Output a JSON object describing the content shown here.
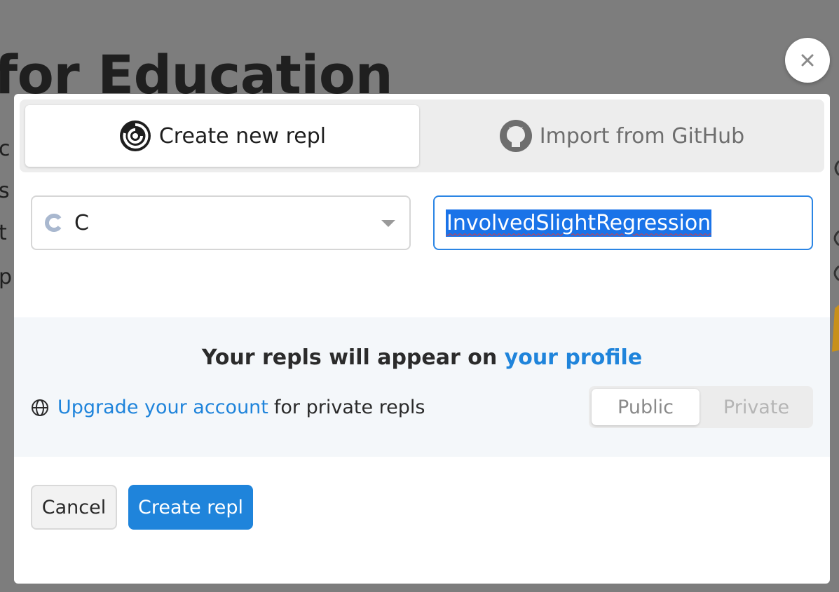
{
  "background": {
    "title": "for Education",
    "fragments": [
      "c",
      "s",
      "t",
      "p"
    ]
  },
  "modal": {
    "tabs": [
      {
        "label": "Create new repl",
        "icon": "replit-swirl-icon",
        "active": true
      },
      {
        "label": "Import from GitHub",
        "icon": "github-icon",
        "active": false
      }
    ],
    "language": {
      "label": "C",
      "icon": "c-language-icon"
    },
    "name_input": {
      "value": "InvolvedSlightRegression"
    },
    "info": {
      "heading_prefix": "Your repls will appear on",
      "heading_link": "your profile",
      "upgrade_link": "Upgrade your account",
      "upgrade_suffix": "for private repls"
    },
    "visibility": {
      "options": [
        "Public",
        "Private"
      ],
      "selected": "Public"
    },
    "buttons": {
      "cancel": "Cancel",
      "create": "Create repl"
    }
  },
  "colors": {
    "accent": "#1f84db",
    "overlay": "#7d7d7d",
    "selection": "#1a73e8"
  }
}
